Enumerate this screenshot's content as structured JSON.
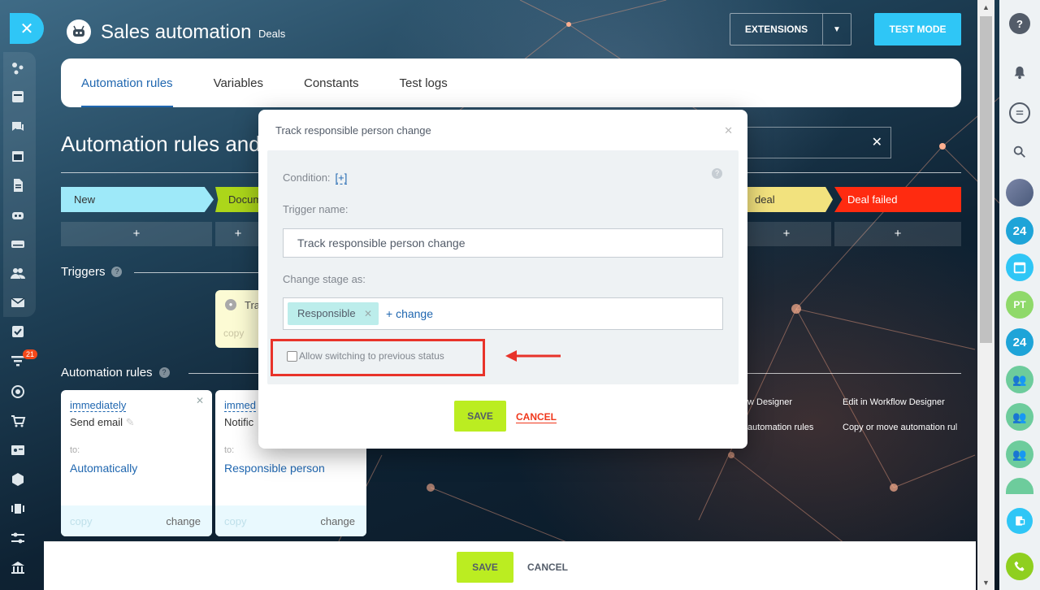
{
  "header": {
    "title": "Sales automation",
    "subtitle": "Deals",
    "extensions_label": "EXTENSIONS",
    "test_mode_label": "TEST MODE"
  },
  "tabs": [
    {
      "label": "Automation rules",
      "active": true
    },
    {
      "label": "Variables"
    },
    {
      "label": "Constants"
    },
    {
      "label": "Test logs"
    }
  ],
  "page": {
    "title": "Automation rules and triggers"
  },
  "stages": [
    {
      "label": "New",
      "color": "#9ee9f9"
    },
    {
      "label": "Documents",
      "color": "#acd61a"
    },
    {
      "label": "deal",
      "color": "#f2e27e"
    },
    {
      "label": "Deal failed",
      "color": "#ff2b10"
    }
  ],
  "plus_label": "+",
  "sections": {
    "triggers": "Triggers",
    "automation_rules": "Automation rules"
  },
  "trigger_card": {
    "name": "Tra",
    "copy": "copy"
  },
  "rule_cards": [
    {
      "when": "immediately",
      "action": "Send email",
      "to_label": "to:",
      "recipient": "Automatically",
      "copy": "copy",
      "change": "change"
    },
    {
      "when": "immed",
      "action": "Notific",
      "to_label": "to:",
      "recipient": "Responsible person",
      "copy": "copy",
      "change": "change"
    }
  ],
  "workflow_links": {
    "left_top": "w Designer",
    "left_bottom": "automation rules",
    "right_top": "Edit in Workflow Designer",
    "right_bottom": "Copy or move automation rul"
  },
  "bottom_bar": {
    "save": "SAVE",
    "cancel": "CANCEL"
  },
  "modal": {
    "title": "Track responsible person change",
    "condition_label": "Condition:",
    "condition_add": "[+]",
    "trigger_name_label": "Trigger name:",
    "trigger_name_value": "Track responsible person change",
    "change_stage_label": "Change stage as:",
    "tag": "Responsible",
    "change_link": "+ change",
    "checkbox_label": "Allow switching to previous status",
    "checkbox_checked": false,
    "save": "SAVE",
    "cancel": "CANCEL"
  },
  "leftbar": {
    "badge": "21"
  },
  "rightbar": {
    "badge_24": "24",
    "initials": "PT"
  },
  "colors": {
    "accent_blue": "#2fc6f6",
    "link_blue": "#2067b0",
    "save_green": "#bbed21",
    "cancel_red": "#f0371b",
    "highlight_red": "#e8332a"
  }
}
